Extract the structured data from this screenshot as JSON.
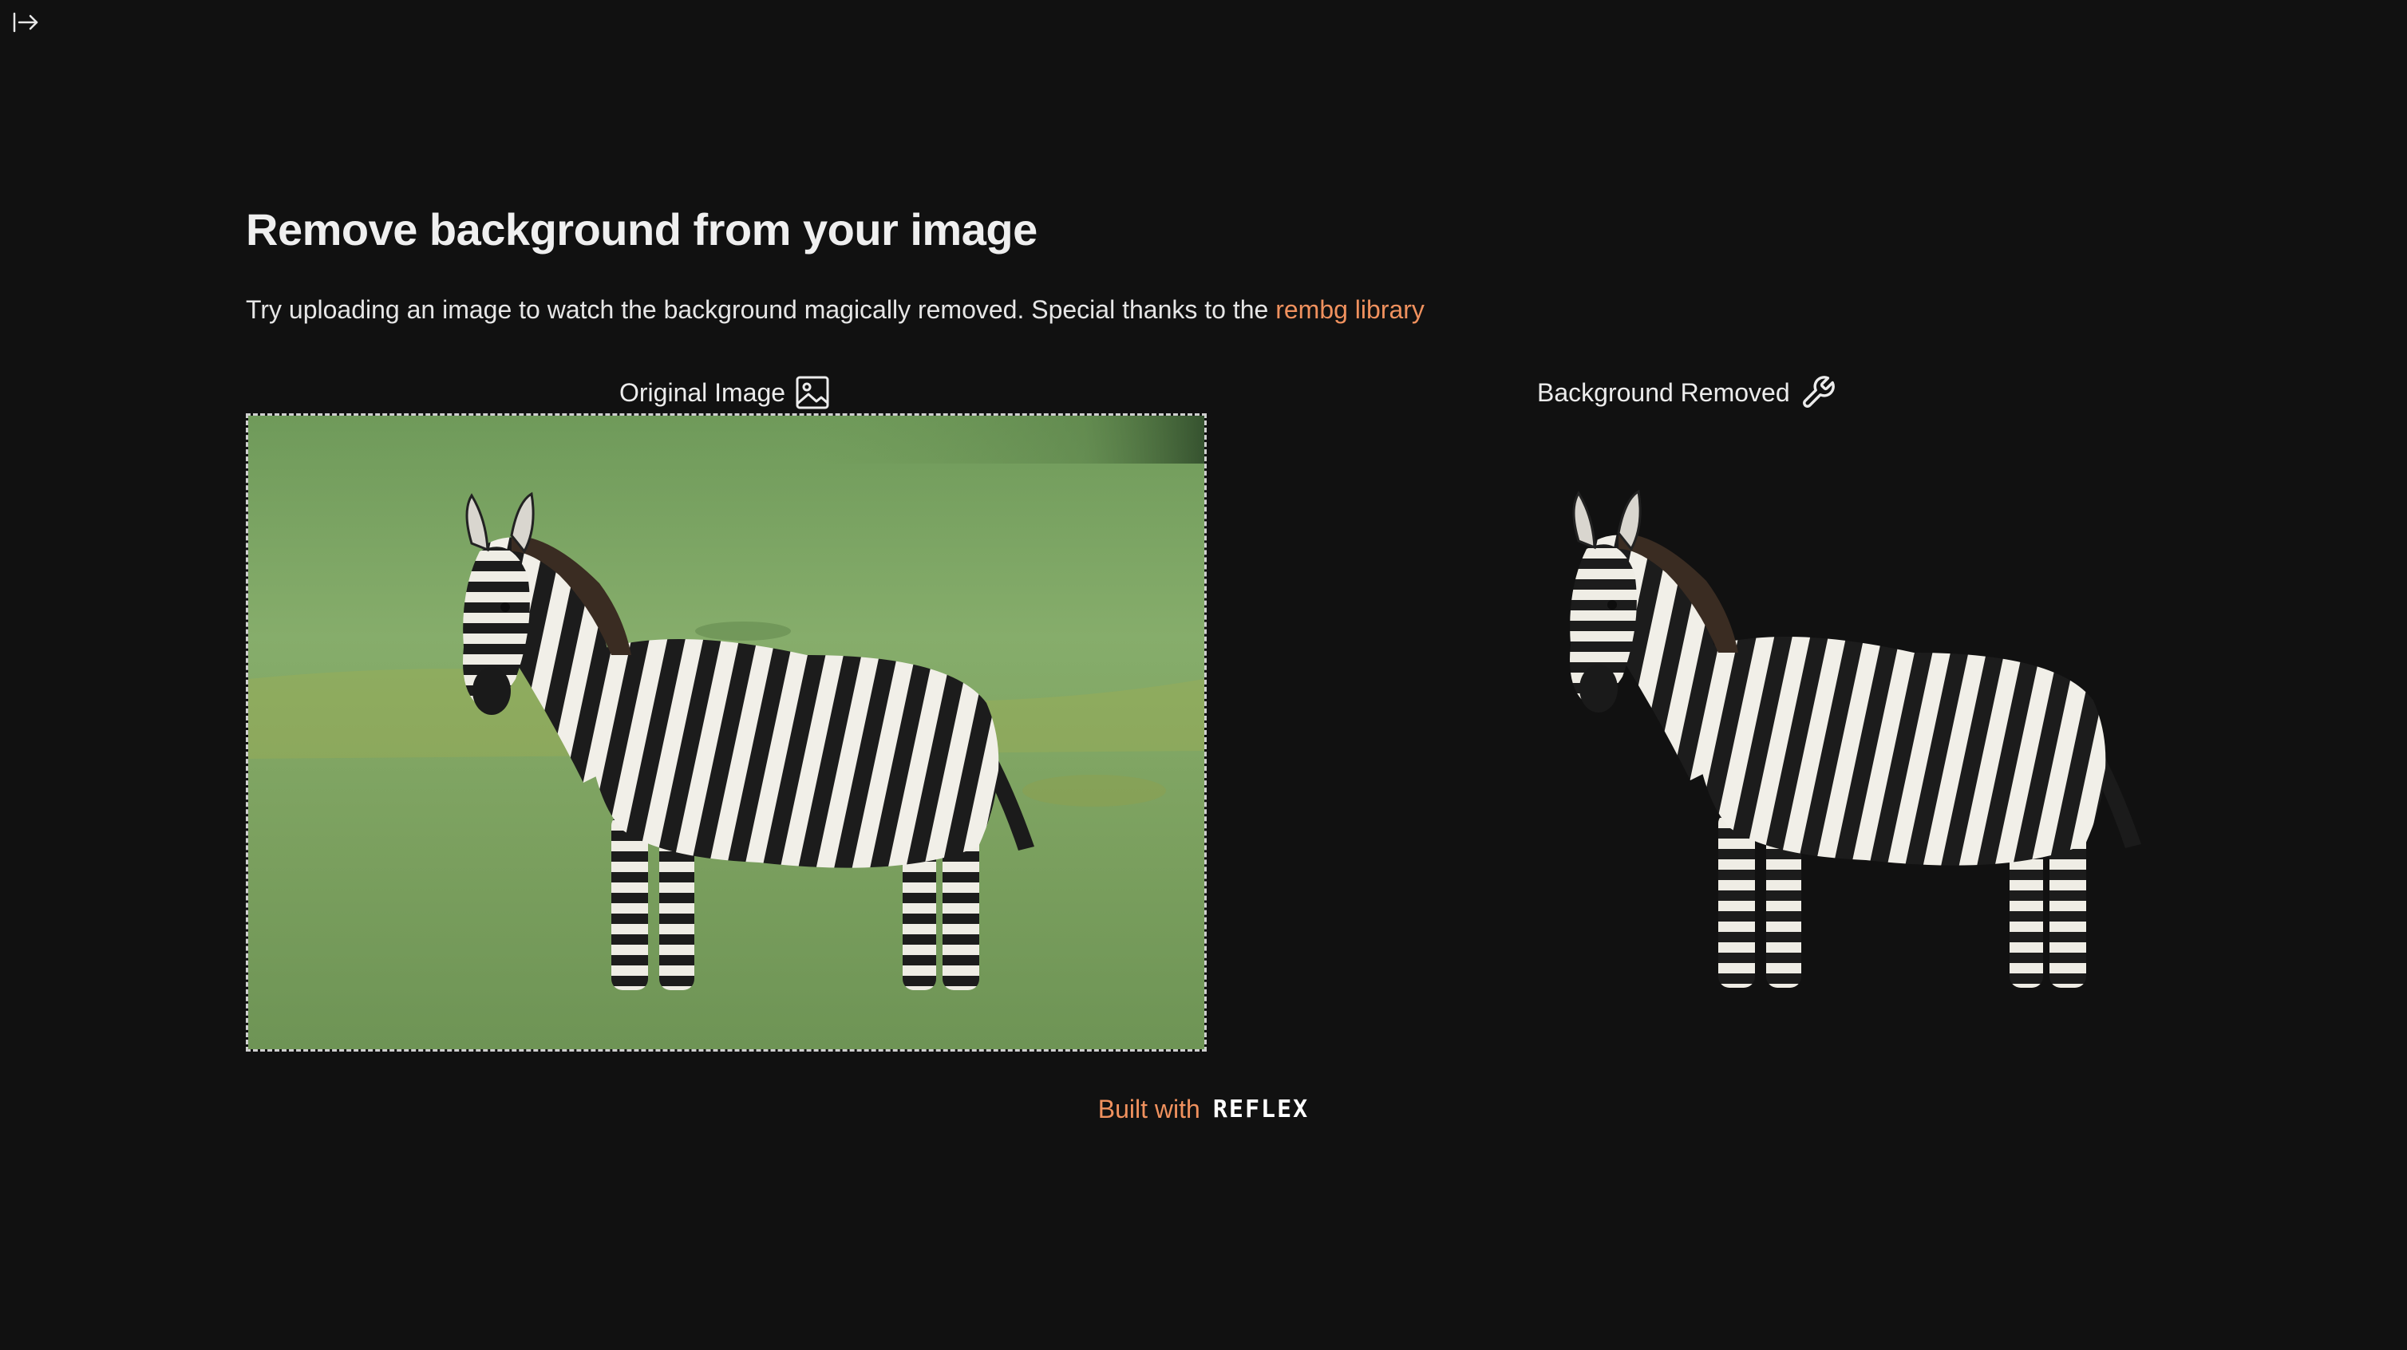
{
  "sidebar_toggle": {
    "icon": "sidebar-expand-icon"
  },
  "header": {
    "title": "Remove background from your image",
    "subtitle_text": "Try uploading an image to watch the background magically removed. Special thanks to the ",
    "subtitle_link": "rembg library"
  },
  "columns": {
    "original_label": "Original Image",
    "original_icon": "image-icon",
    "removed_label": "Background Removed",
    "removed_icon": "wrench-icon"
  },
  "footer": {
    "built_with": "Built with",
    "logo_text": "REFLEX"
  },
  "colors": {
    "background": "#111111",
    "accent": "#f0915e",
    "text": "#eaeaea"
  }
}
